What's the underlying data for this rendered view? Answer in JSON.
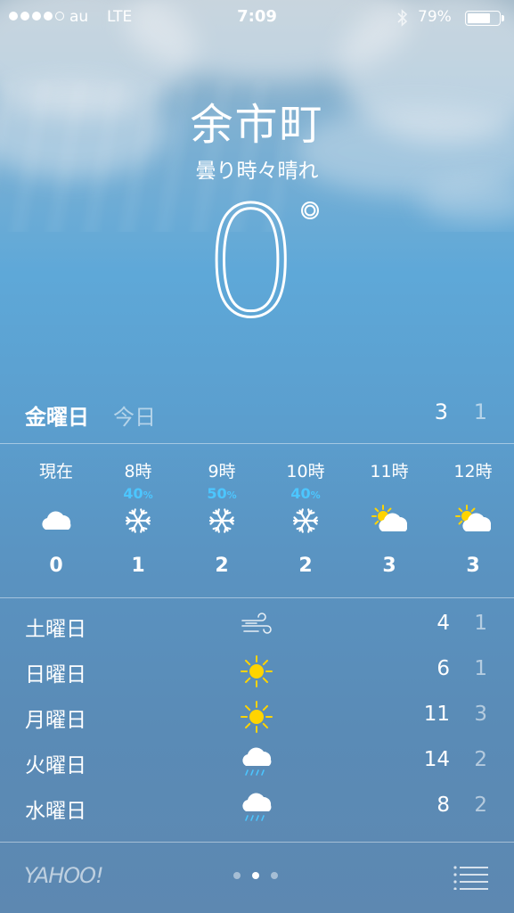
{
  "status_bar": {
    "carrier": "au",
    "network": "LTE",
    "time": "7:09",
    "battery": "79%",
    "battery_level": 0.79
  },
  "location": {
    "city": "余市町",
    "condition": "曇り時々晴れ",
    "temperature": "0",
    "degree_symbol": "°"
  },
  "today": {
    "day": "金曜日",
    "label": "今日",
    "high": "3",
    "low": "1"
  },
  "hourly": [
    {
      "time": "現在",
      "pop": "",
      "icon": "cloud-icon",
      "temp": "0"
    },
    {
      "time": "8時",
      "pop": "40",
      "icon": "snow-icon",
      "temp": "1"
    },
    {
      "time": "9時",
      "pop": "50",
      "icon": "snow-icon",
      "temp": "2"
    },
    {
      "time": "10時",
      "pop": "40",
      "icon": "snow-icon",
      "temp": "2"
    },
    {
      "time": "11時",
      "pop": "",
      "icon": "partly-sunny-icon",
      "temp": "3"
    },
    {
      "time": "12時",
      "pop": "",
      "icon": "partly-sunny-icon",
      "temp": "3"
    }
  ],
  "pop_unit": "%",
  "daily": [
    {
      "day": "土曜日",
      "icon": "wind-icon",
      "high": "4",
      "low": "1"
    },
    {
      "day": "日曜日",
      "icon": "sun-icon",
      "high": "6",
      "low": "1"
    },
    {
      "day": "月曜日",
      "icon": "sun-icon",
      "high": "11",
      "low": "3"
    },
    {
      "day": "火曜日",
      "icon": "rain-icon",
      "high": "14",
      "low": "2"
    },
    {
      "day": "水曜日",
      "icon": "rain-icon",
      "high": "8",
      "low": "2"
    }
  ],
  "footer": {
    "brand": "YAHOO!",
    "pages": 3,
    "active_page": 2
  },
  "colors": {
    "precip_percent": "#4cc6ff",
    "sun": "#ffd400"
  }
}
